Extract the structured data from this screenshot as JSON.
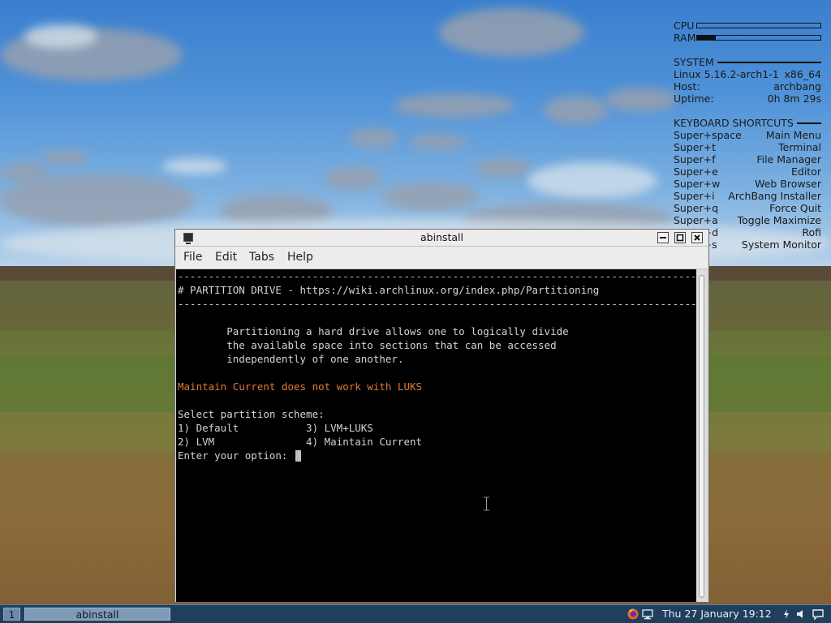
{
  "conky": {
    "cpu_label": "CPU",
    "cpu_usage": 0.0,
    "ram_label": "RAM",
    "ram_usage": 0.15,
    "system_heading": "SYSTEM",
    "system_rows": [
      {
        "key": "Linux 5.16.2-arch1-1",
        "value": "x86_64"
      },
      {
        "key": "Host:",
        "value": "archbang"
      },
      {
        "key": "Uptime:",
        "value": "0h 8m 29s"
      }
    ],
    "shortcuts_heading": "KEYBOARD SHORTCUTS",
    "shortcuts": [
      {
        "key": "Super+space",
        "value": "Main Menu"
      },
      {
        "key": "Super+t",
        "value": "Terminal"
      },
      {
        "key": "Super+f",
        "value": "File Manager"
      },
      {
        "key": "Super+e",
        "value": "Editor"
      },
      {
        "key": "Super+w",
        "value": "Web Browser"
      },
      {
        "key": "Super+i",
        "value": "ArchBang Installer"
      },
      {
        "key": "Super+q",
        "value": "Force Quit"
      },
      {
        "key": "Super+a",
        "value": "Toggle Maximize"
      },
      {
        "key": "Super+d",
        "value": "Rofi"
      },
      {
        "key": "Super+s",
        "value": "System Monitor"
      }
    ]
  },
  "window": {
    "title": "abinstall",
    "menu": [
      "File",
      "Edit",
      "Tabs",
      "Help"
    ]
  },
  "terminal": {
    "rule": "-----------------------------------------------------------------------------------------------",
    "heading": "# PARTITION DRIVE - https://wiki.archlinux.org/index.php/Partitioning",
    "desc_lines": [
      "        Partitioning a hard drive allows one to logically divide",
      "        the available space into sections that can be accessed",
      "        independently of one another."
    ],
    "warning": "Maintain Current does not work with LUKS",
    "prompt_title": "Select partition scheme:",
    "options_row1": "1) Default           3) LVM+LUKS",
    "options_row2": "2) LVM               4) Maintain Current",
    "input_prompt": "Enter your option: "
  },
  "taskbar": {
    "workspace": "1",
    "task_label": "abinstall",
    "clock": "Thu 27 January  19:12"
  },
  "colors": {
    "terminal_bg": "#000000",
    "terminal_fg": "#d4d4d4",
    "warning": "#e07b3a",
    "taskbar_bg": "#1f3f5c"
  }
}
